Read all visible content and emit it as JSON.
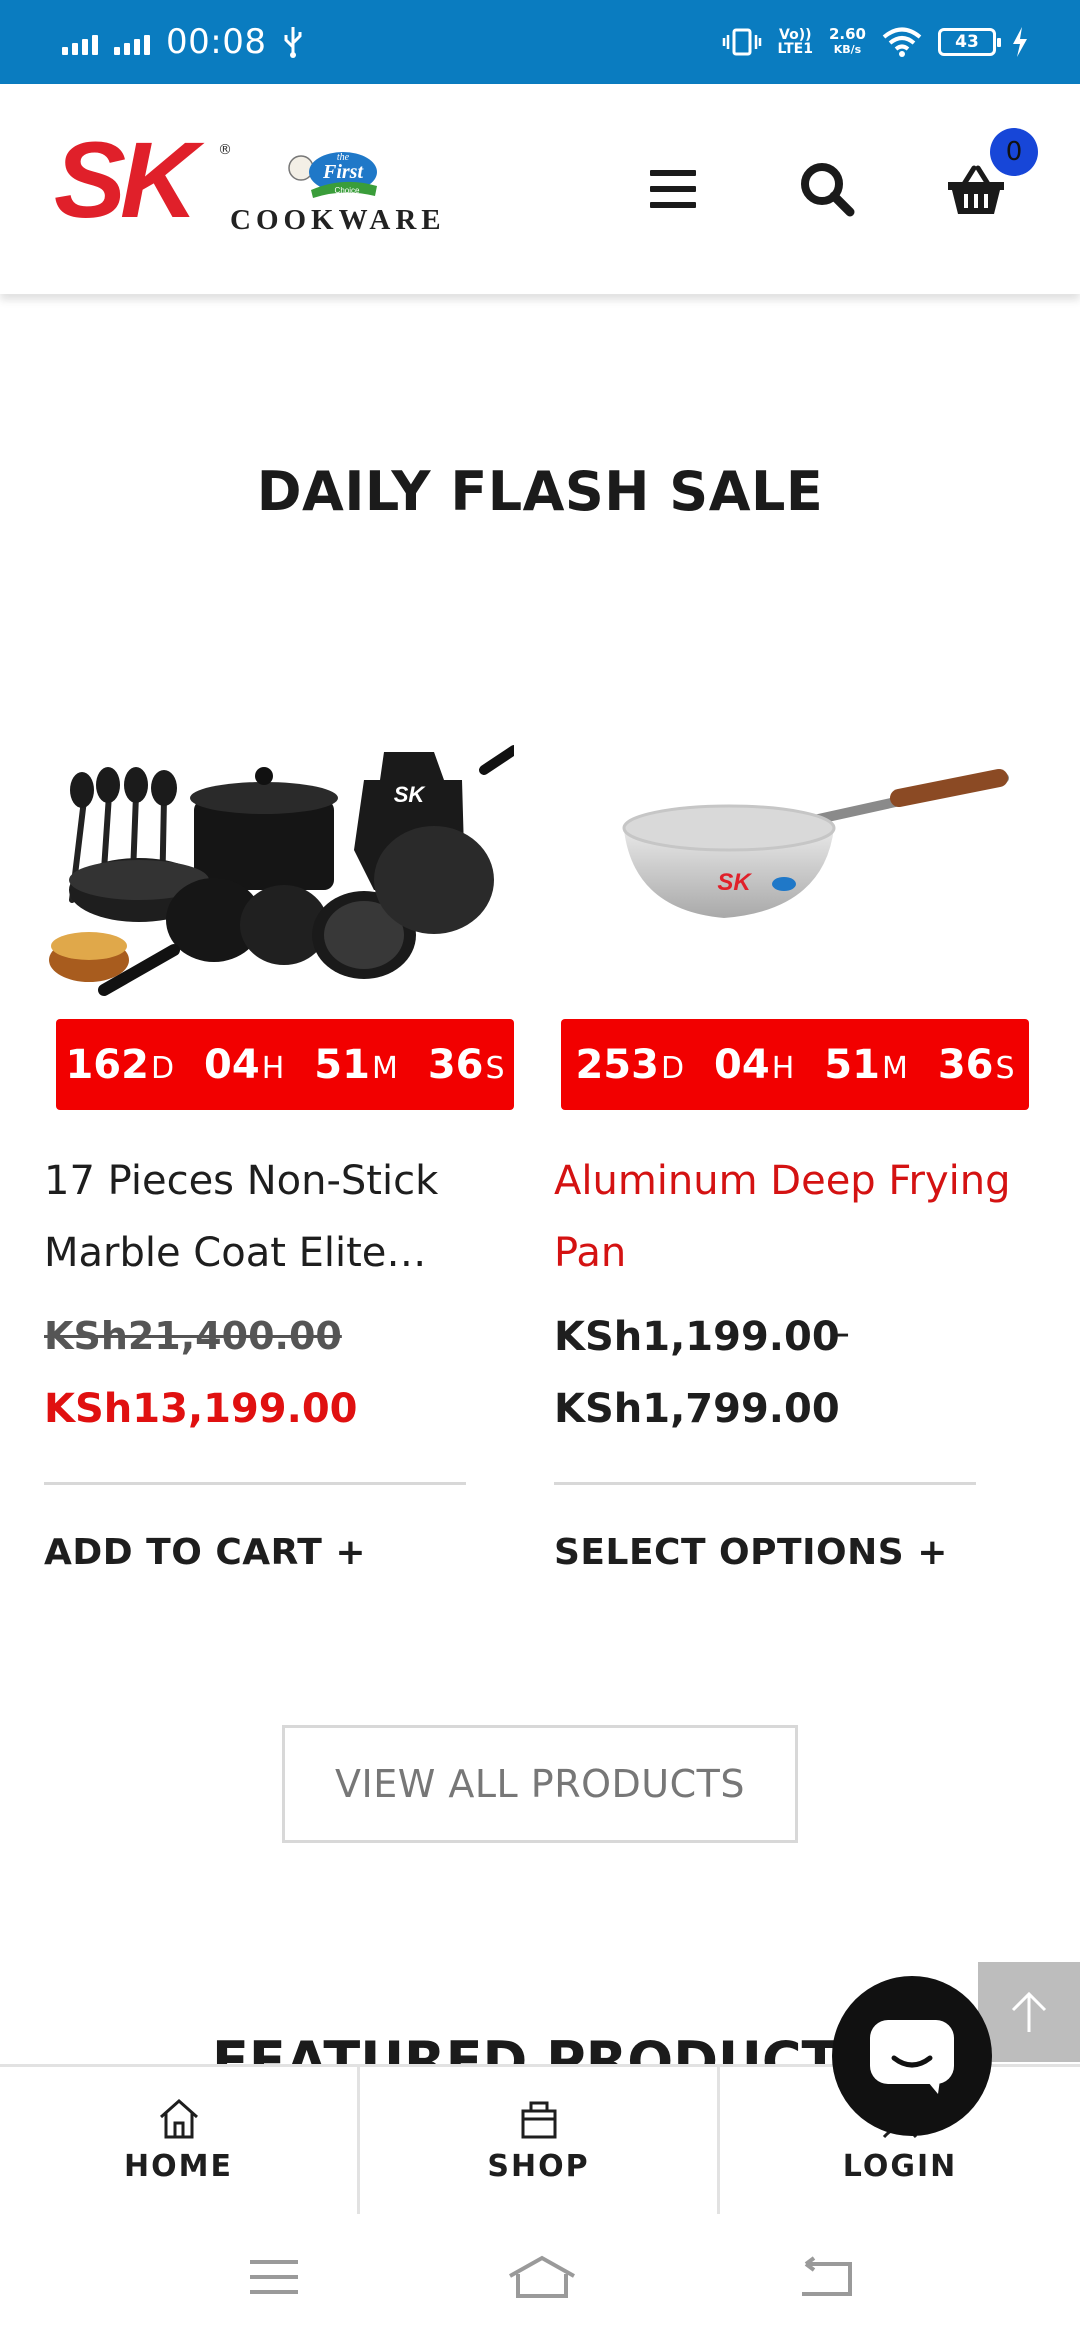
{
  "status_bar": {
    "time": "00:08",
    "volte_line1": "Vo))",
    "volte_line2": "LTE1",
    "speed_value": "2.60",
    "speed_unit": "KB/s",
    "battery": "43"
  },
  "header": {
    "logo_text": "SK",
    "logo_registered": "®",
    "logo_badge_line1": "the",
    "logo_badge_line2": "First",
    "logo_badge_line3": "Choice",
    "logo_subtitle": "COOKWARE",
    "cart_count": "0"
  },
  "flash_sale": {
    "title": "DAILY FLASH SALE",
    "products": [
      {
        "name": "17 Pieces Non-Stick Marble Coat Elite…",
        "timer": {
          "days": "162",
          "hours": "04",
          "minutes": "51",
          "seconds": "36"
        },
        "price_old": "KSh21,400.00",
        "price_new": "KSh13,199.00",
        "action": "ADD TO CART +"
      },
      {
        "name": "Aluminum Deep Frying Pan",
        "timer": {
          "days": "253",
          "hours": "04",
          "minutes": "51",
          "seconds": "36"
        },
        "price_min": "KSh1,199.00",
        "price_sep": "–",
        "price_max": "KSh1,799.00",
        "action": "SELECT OPTIONS +"
      }
    ],
    "unit_d": "D",
    "unit_h": "H",
    "unit_m": "M",
    "unit_s": "S",
    "view_all": "VIEW ALL PRODUCTS"
  },
  "featured": {
    "title": "FEATURED PRODUCTS"
  },
  "bottom_nav": {
    "items": [
      {
        "label": "HOME",
        "icon": "home-icon"
      },
      {
        "label": "SHOP",
        "icon": "shop-bag-icon"
      },
      {
        "label": "LOGIN",
        "icon": "user-icon"
      }
    ]
  },
  "colors": {
    "status_bar": "#0a7cc0",
    "brand_red": "#e0202a",
    "timer_red": "#f20000",
    "sale_price": "#e01010",
    "cart_badge": "#1746d8"
  }
}
